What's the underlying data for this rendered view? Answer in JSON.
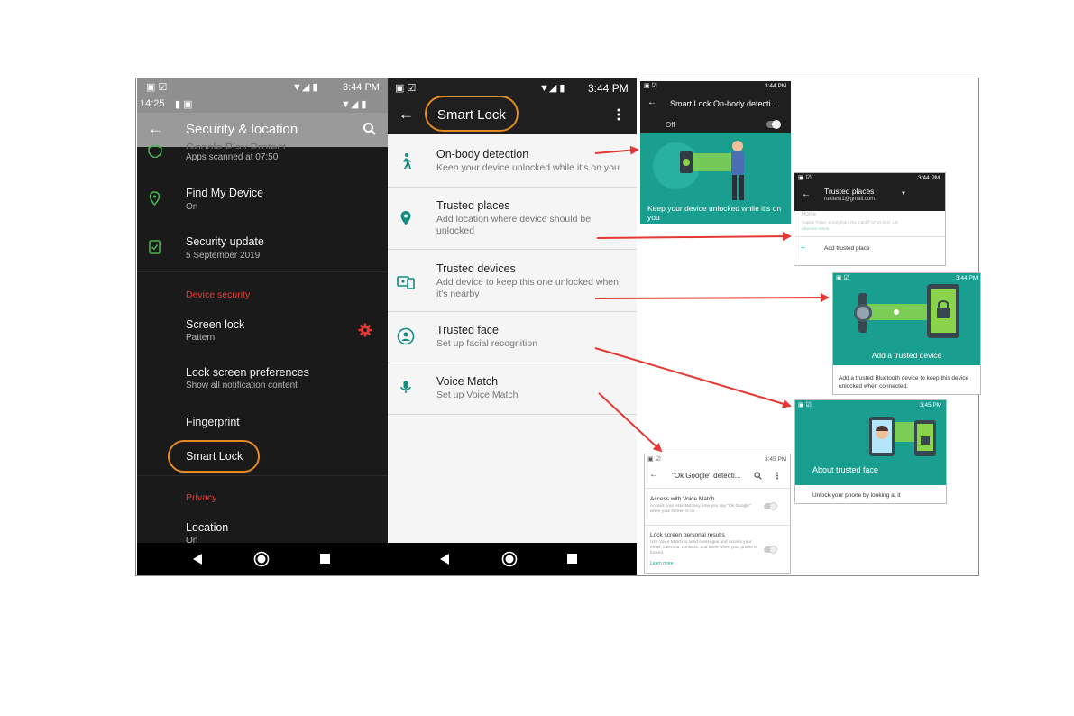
{
  "left_phone": {
    "status_time_top": "3:44 PM",
    "status_time_second": "14:25",
    "app_title": "Security & location",
    "items": [
      {
        "title": "Google Play Protect",
        "subtitle": "Apps scanned at 07:50"
      },
      {
        "title": "Find My Device",
        "subtitle": "On"
      },
      {
        "title": "Security update",
        "subtitle": "5 September 2019"
      }
    ],
    "section_device_security": "Device security",
    "device_items": [
      {
        "title": "Screen lock",
        "subtitle": "Pattern"
      },
      {
        "title": "Lock screen preferences",
        "subtitle": "Show all notification content"
      },
      {
        "title": "Fingerprint"
      },
      {
        "title": "Smart Lock"
      }
    ],
    "section_privacy": "Privacy",
    "privacy_items": [
      {
        "title": "Location",
        "subtitle": "On"
      }
    ]
  },
  "middle_phone": {
    "status_time": "3:44 PM",
    "app_title": "Smart Lock",
    "rows": [
      {
        "icon": "walk-icon",
        "title": "On-body detection",
        "subtitle": "Keep your device unlocked while it's on you"
      },
      {
        "icon": "location-pin-icon",
        "title": "Trusted places",
        "subtitle": "Add location where device should be unlocked"
      },
      {
        "icon": "devices-icon",
        "title": "Trusted devices",
        "subtitle": "Add device to keep this one unlocked when it's nearby"
      },
      {
        "icon": "face-icon",
        "title": "Trusted face",
        "subtitle": "Set up facial recognition"
      },
      {
        "icon": "mic-icon",
        "title": "Voice Match",
        "subtitle": "Set up Voice Match"
      }
    ]
  },
  "onbody_card": {
    "time": "3:44 PM",
    "title": "Smart Lock On-body detecti...",
    "toggle_label": "Off",
    "caption": "Keep your device unlocked while it's on you"
  },
  "trusted_places_card": {
    "time": "3:44 PM",
    "title": "Trusted places",
    "account": "rokitest1@gmail.com",
    "home_label": "Home",
    "home_address": "Capital Tower, 6 Greyfriars Rd, Cardiff CF10 3AG, UK",
    "home_link": "Ulteriore Home",
    "add_label": "Add trusted place"
  },
  "trusted_device_card": {
    "time": "3:44 PM",
    "caption": "Add a trusted device",
    "body": "Add a trusted Bluetooth device to keep this device unlocked when connected."
  },
  "trusted_face_card": {
    "time": "3:45 PM",
    "caption": "About trusted face",
    "body": "Unlock your phone by looking at it"
  },
  "voice_card": {
    "time": "3:45 PM",
    "title": "\"Ok Google\" detecti...",
    "item1_title": "Access with Voice Match",
    "item1_body": "Access your Assistant any time you say \"Ok Google\" when your screen is on",
    "item2_title": "Lock screen personal results",
    "item2_body": "Use Voice Match to send messages and access your email, calendar, contacts, and more when your phone is locked.",
    "item2_link": "Learn more"
  },
  "colors": {
    "teal": "#1a9e8f",
    "teal_dark": "#148c80",
    "highlight_orange": "#e58a1f",
    "arrow_red": "#e53935",
    "section_red": "#e53935"
  }
}
